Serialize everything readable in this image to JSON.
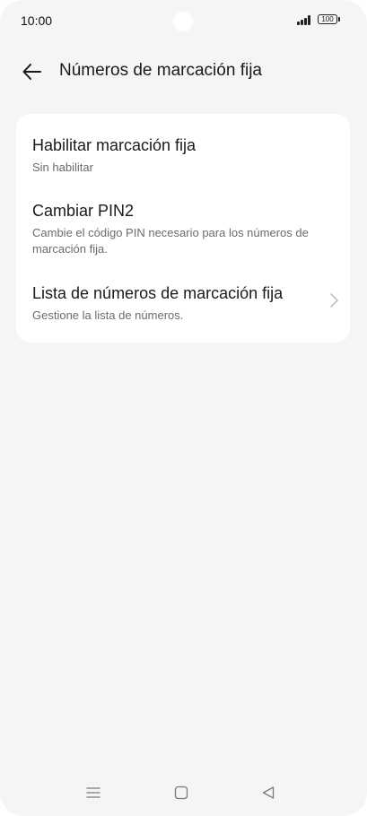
{
  "status_bar": {
    "time": "10:00",
    "battery": "100",
    "icons": [
      "signal-icon",
      "battery-icon"
    ]
  },
  "header": {
    "title": "Números de marcación fija",
    "back_icon": "arrow-left-icon"
  },
  "settings": {
    "items": [
      {
        "title": "Habilitar marcación fija",
        "subtitle": "Sin habilitar"
      },
      {
        "title": "Cambiar PIN2",
        "subtitle": "Cambie el código PIN necesario para los números de marcación fija."
      },
      {
        "title": "Lista de números de marcación fija",
        "subtitle": "Gestione la lista de números.",
        "icon": "chevron-right-icon"
      }
    ]
  },
  "nav_bar": {
    "icons": [
      "menu-icon",
      "home-icon",
      "back-triangle-icon"
    ]
  },
  "colors": {
    "background": "#f5f5f5",
    "card": "#ffffff",
    "primary_text": "#1a1a1a",
    "secondary_text": "#6b6b6b"
  }
}
